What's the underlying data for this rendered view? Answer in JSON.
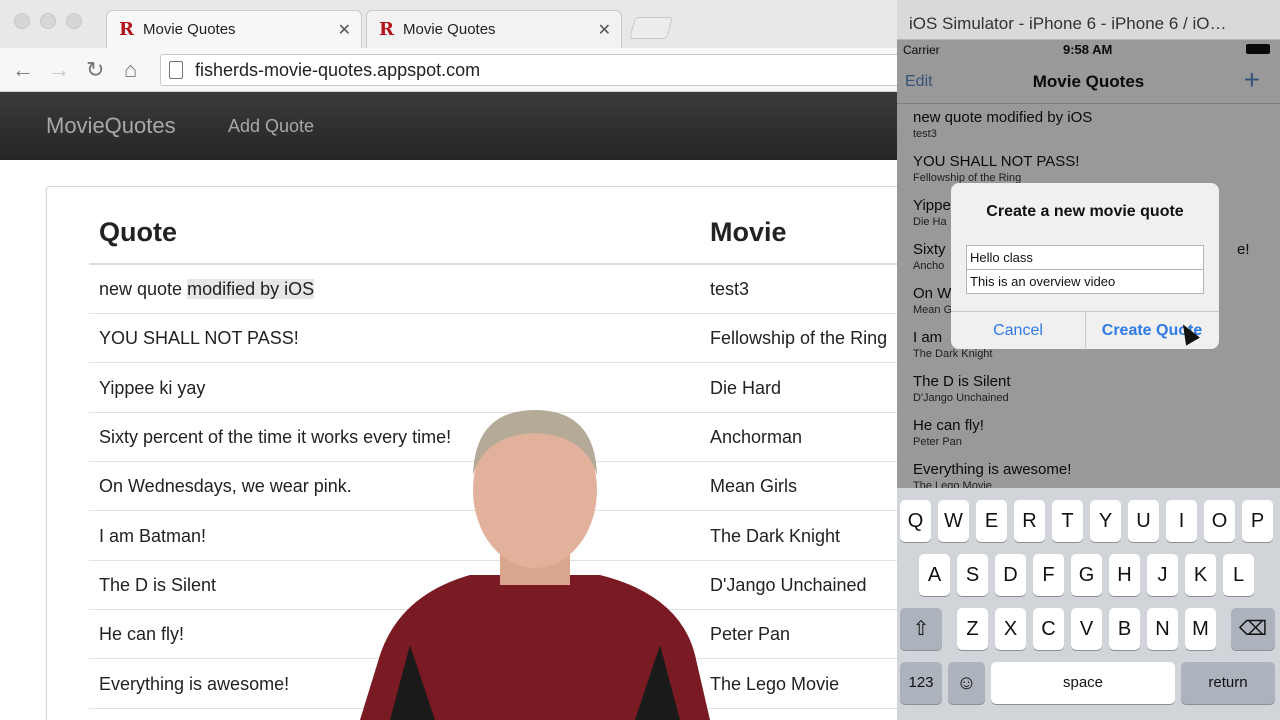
{
  "browser": {
    "tabs": [
      {
        "title": "Movie Quotes"
      },
      {
        "title": "Movie Quotes"
      }
    ],
    "url": "fisherds-movie-quotes.appspot.com"
  },
  "site": {
    "brand": "MovieQuotes",
    "nav_add": "Add Quote",
    "table": {
      "headers": {
        "quote": "Quote",
        "movie": "Movie"
      },
      "rows": [
        {
          "quote_a": "new quote ",
          "quote_b": "modified by iOS",
          "movie": "test3"
        },
        {
          "quote": "YOU SHALL NOT PASS!",
          "movie": "Fellowship of the Ring"
        },
        {
          "quote": "Yippee ki yay",
          "movie": "Die Hard"
        },
        {
          "quote": "Sixty percent of the time it works every time!",
          "movie": "Anchorman"
        },
        {
          "quote": "On Wednesdays, we wear pink.",
          "movie": "Mean Girls"
        },
        {
          "quote": "I am Batman!",
          "movie": "The Dark Knight"
        },
        {
          "quote": "The D is Silent",
          "movie": "D'Jango Unchained"
        },
        {
          "quote": "He can fly!",
          "movie": "Peter Pan"
        },
        {
          "quote": "Everything is awesome!",
          "movie": "The Lego Movie"
        }
      ]
    }
  },
  "simulator": {
    "window_title": "iOS Simulator - iPhone 6 - iPhone 6 / iO…",
    "status": {
      "carrier": "Carrier",
      "time": "9:58 AM"
    },
    "nav": {
      "edit": "Edit",
      "title": "Movie Quotes",
      "add": "+"
    },
    "cells": [
      {
        "title": "new quote modified by iOS",
        "subtitle": "test3"
      },
      {
        "title": "YOU SHALL NOT PASS!",
        "subtitle": "Fellowship of the Ring"
      },
      {
        "title": "Yippe",
        "subtitle": "Die Ha"
      },
      {
        "title": "Sixty",
        "subtitle": "Ancho",
        "trail": "e!"
      },
      {
        "title": "On W",
        "subtitle": "Mean G"
      },
      {
        "title": "I am",
        "subtitle": "The Dark Knight"
      },
      {
        "title": "The D is Silent",
        "subtitle": "D'Jango Unchained"
      },
      {
        "title": "He can fly!",
        "subtitle": "Peter Pan"
      },
      {
        "title": "Everything is awesome!",
        "subtitle": "The Lego Movie"
      }
    ],
    "alert": {
      "title": "Create a new movie quote",
      "field1": "Hello class",
      "field2": "This is an overview video",
      "cancel": "Cancel",
      "create": "Create Quote"
    },
    "keyboard": {
      "row1": [
        "Q",
        "W",
        "E",
        "R",
        "T",
        "Y",
        "U",
        "I",
        "O",
        "P"
      ],
      "row2": [
        "A",
        "S",
        "D",
        "F",
        "G",
        "H",
        "J",
        "K",
        "L"
      ],
      "row3": [
        "Z",
        "X",
        "C",
        "V",
        "B",
        "N",
        "M"
      ],
      "numbers": "123",
      "space": "space",
      "return": "return"
    }
  },
  "colors": {
    "navbar": "#2f2f2f",
    "ios_tint": "#2f7ae5",
    "brand_favicon": "#b3141c"
  }
}
